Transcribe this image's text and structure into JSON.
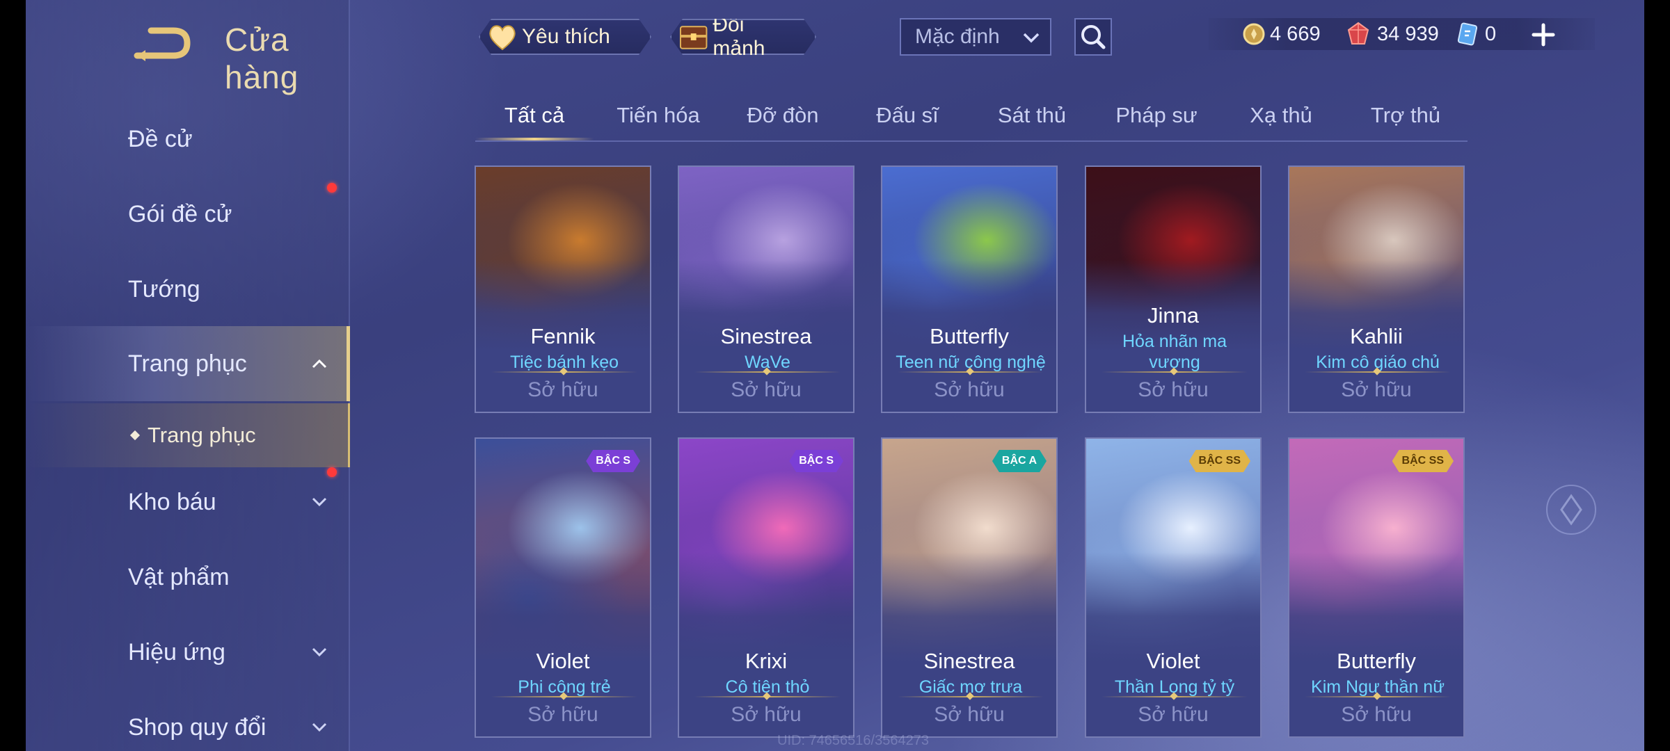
{
  "header": {
    "title": "Cửa hàng",
    "favorites_label": "Yêu thích",
    "exchange_label": "Đổi mảnh",
    "sort": {
      "selected": "Mặc định"
    },
    "currencies": [
      {
        "icon": "gold-coin-icon",
        "value": "4 669"
      },
      {
        "icon": "ruby-gem-icon",
        "value": "34 939"
      },
      {
        "icon": "voucher-card-icon",
        "value": "0"
      }
    ]
  },
  "sidebar": {
    "items": [
      {
        "label": "Đề cử"
      },
      {
        "label": "Gói đề cử",
        "dot": true
      },
      {
        "label": "Tướng"
      },
      {
        "label": "Trang phục",
        "expanded": true
      },
      {
        "label": "Trang phục",
        "sub": true
      },
      {
        "label": "Kho báu",
        "dot": true
      },
      {
        "label": "Vật phẩm"
      },
      {
        "label": "Hiệu ứng"
      },
      {
        "label": "Shop quy đổi"
      }
    ]
  },
  "tabs": [
    "Tất cả",
    "Tiến hóa",
    "Đỡ đòn",
    "Đấu sĩ",
    "Sát thủ",
    "Pháp sư",
    "Xạ thủ",
    "Trợ thủ"
  ],
  "active_tab": "Tất cả",
  "cards": [
    {
      "hero": "Fennik",
      "skin": "Tiệc bánh kẹo",
      "status": "Sở hữu",
      "tier": ""
    },
    {
      "hero": "Sinestrea",
      "skin": "WaVe",
      "status": "Sở hữu",
      "tier": ""
    },
    {
      "hero": "Butterfly",
      "skin": "Teen nữ công nghệ",
      "status": "Sở hữu",
      "tier": ""
    },
    {
      "hero": "Jinna",
      "skin": "Hỏa nhãn ma vương",
      "status": "Sở hữu",
      "tier": ""
    },
    {
      "hero": "Kahlii",
      "skin": "Kim cô giáo chủ",
      "status": "Sở hữu",
      "tier": ""
    },
    {
      "hero": "Violet",
      "skin": "Phi công trẻ",
      "status": "Sở hữu",
      "tier": "BẬC S"
    },
    {
      "hero": "Krixi",
      "skin": "Cô tiên thỏ",
      "status": "Sở hữu",
      "tier": "BẬC S"
    },
    {
      "hero": "Sinestrea",
      "skin": "Giấc mơ trưa",
      "status": "Sở hữu",
      "tier": "BẬC A"
    },
    {
      "hero": "Violet",
      "skin": "Thần Long tỷ tỷ",
      "status": "Sở hữu",
      "tier": "BẬC SS"
    },
    {
      "hero": "Butterfly",
      "skin": "Kim Ngư thần nữ",
      "status": "Sở hữu",
      "tier": "BẬC SS"
    }
  ],
  "colors": {
    "accent_gold": "#e6cf8c",
    "skin_name": "#6fd6ff",
    "tier_s": "#7b3fd6",
    "tier_a": "#1aa6a0",
    "tier_ss": "#e0b448"
  },
  "footer": {
    "uid": "UID: 74656516/3564273"
  }
}
